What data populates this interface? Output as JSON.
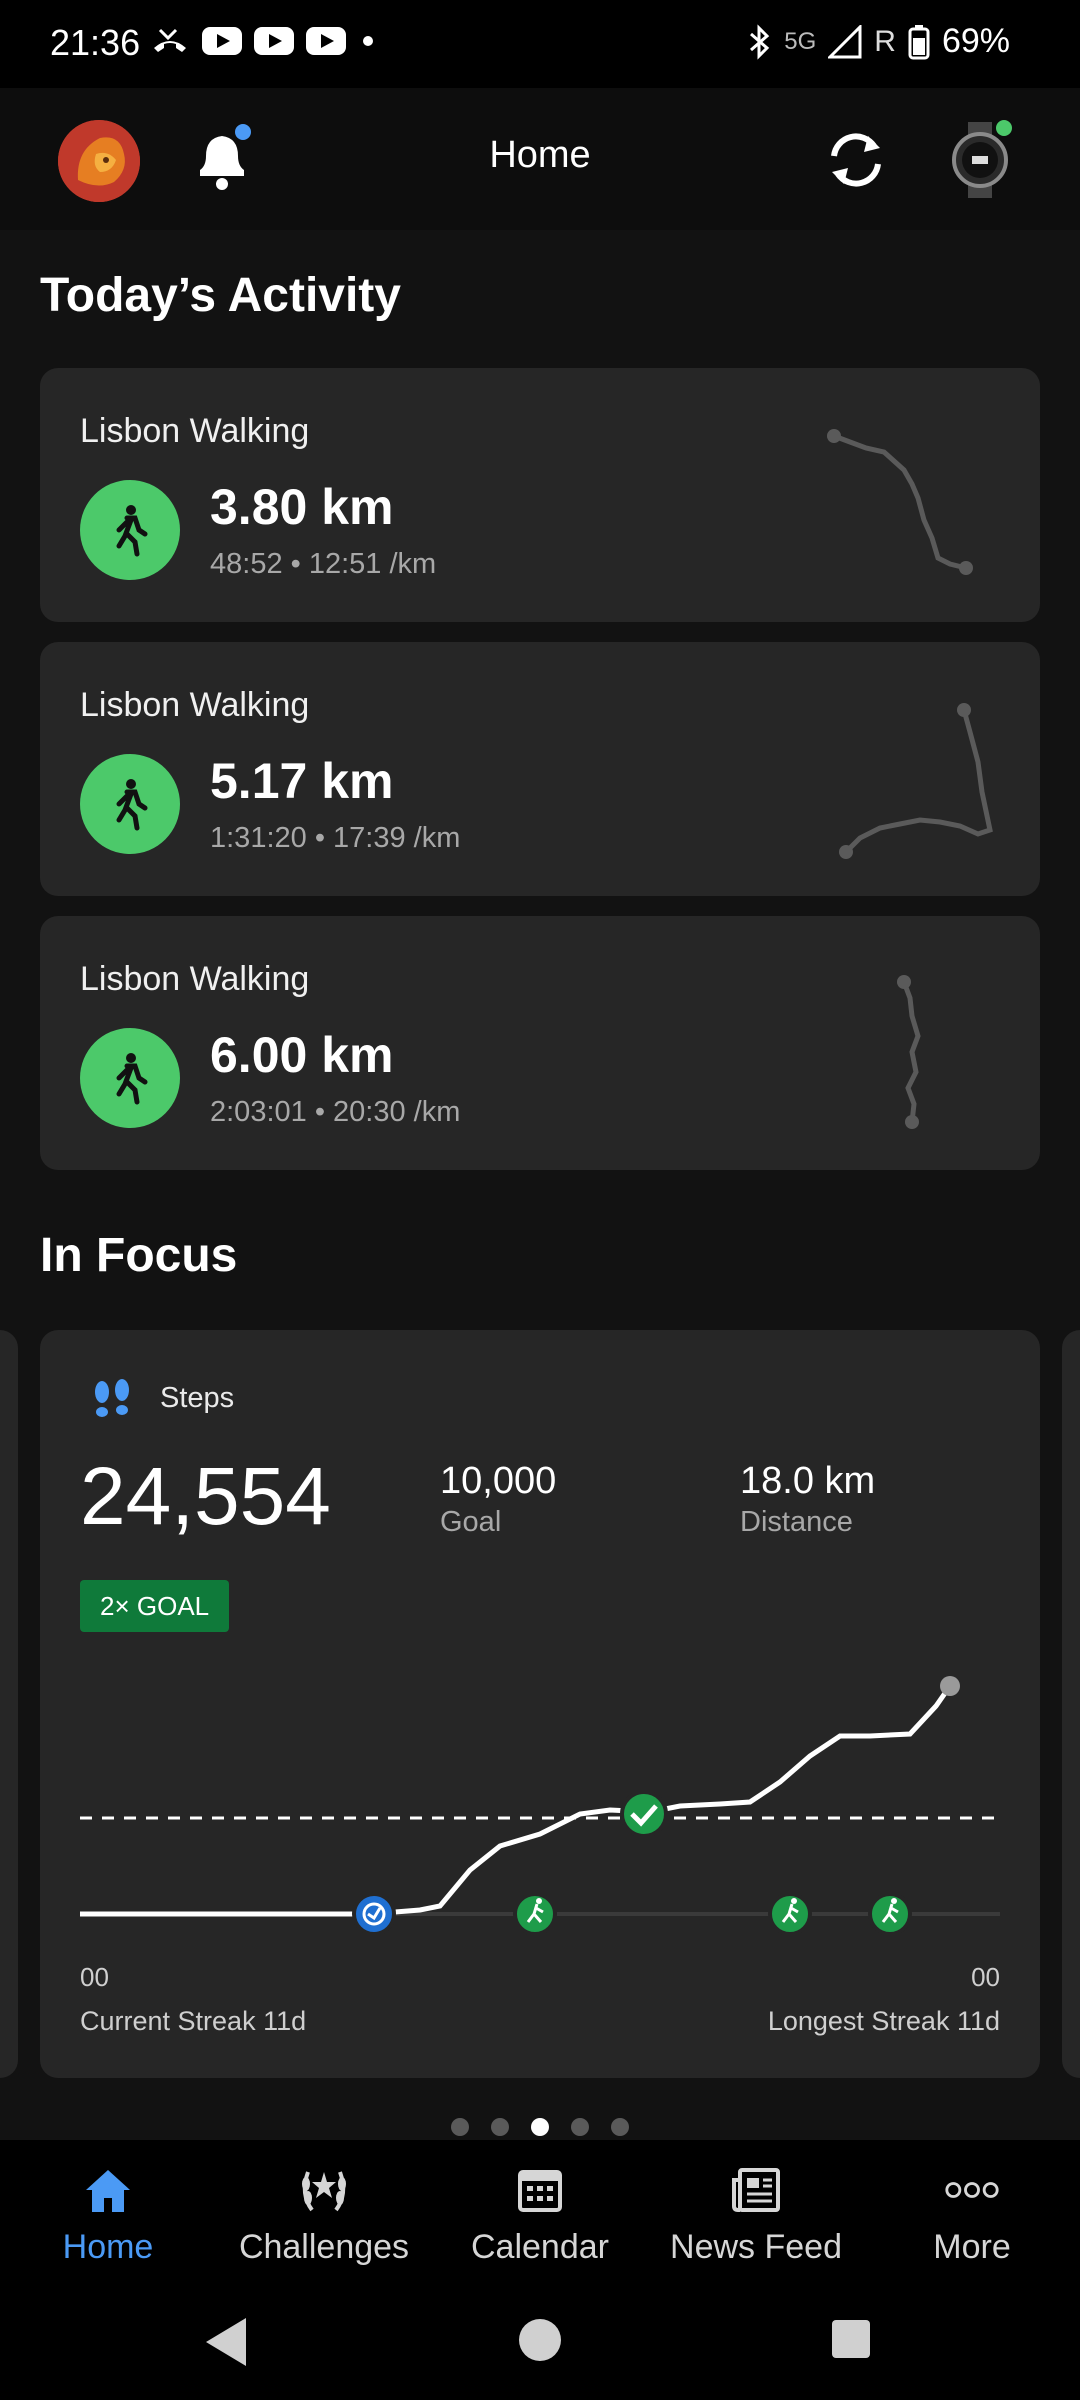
{
  "status_bar": {
    "time": "21:36",
    "network": "5G",
    "roaming": "R",
    "battery": "69%",
    "icons": [
      "missed-call-icon",
      "youtube-icon",
      "youtube-icon",
      "youtube-icon",
      "dot-icon",
      "bluetooth-icon",
      "signal-icon",
      "battery-icon"
    ]
  },
  "app_bar": {
    "title": "Home",
    "notification_badge_color": "#4b9af5",
    "device_status_color": "#4cc96a"
  },
  "today": {
    "title": "Today’s Activity",
    "activities": [
      {
        "name": "Lisbon Walking",
        "distance": "3.80 km",
        "details": "48:52 • 12:51 /km"
      },
      {
        "name": "Lisbon Walking",
        "distance": "5.17 km",
        "details": "1:31:20 • 17:39 /km"
      },
      {
        "name": "Lisbon Walking",
        "distance": "6.00 km",
        "details": "2:03:01 • 20:30 /km"
      }
    ]
  },
  "focus": {
    "title": "In Focus",
    "card": {
      "label": "Steps",
      "steps": "24,554",
      "goal_value": "10,000",
      "goal_label": "Goal",
      "distance_value": "18.0 km",
      "distance_label": "Distance",
      "badge": "2× GOAL",
      "axis_start": "00",
      "axis_end": "00",
      "current_streak": "Current Streak 11d",
      "longest_streak": "Longest Streak 11d"
    },
    "pager": {
      "count": 5,
      "active": 3
    }
  },
  "bottom_nav": {
    "items": [
      {
        "label": "Home",
        "icon": "home-icon",
        "active": true
      },
      {
        "label": "Challenges",
        "icon": "laurel-icon",
        "active": false
      },
      {
        "label": "Calendar",
        "icon": "calendar-icon",
        "active": false
      },
      {
        "label": "News Feed",
        "icon": "news-icon",
        "active": false
      },
      {
        "label": "More",
        "icon": "more-icon",
        "active": false
      }
    ]
  },
  "colors": {
    "accent": "#4b9af5",
    "walk_green": "#4cc96a",
    "badge_green": "#0f7a3a",
    "card": "#262626",
    "background": "#121212"
  }
}
